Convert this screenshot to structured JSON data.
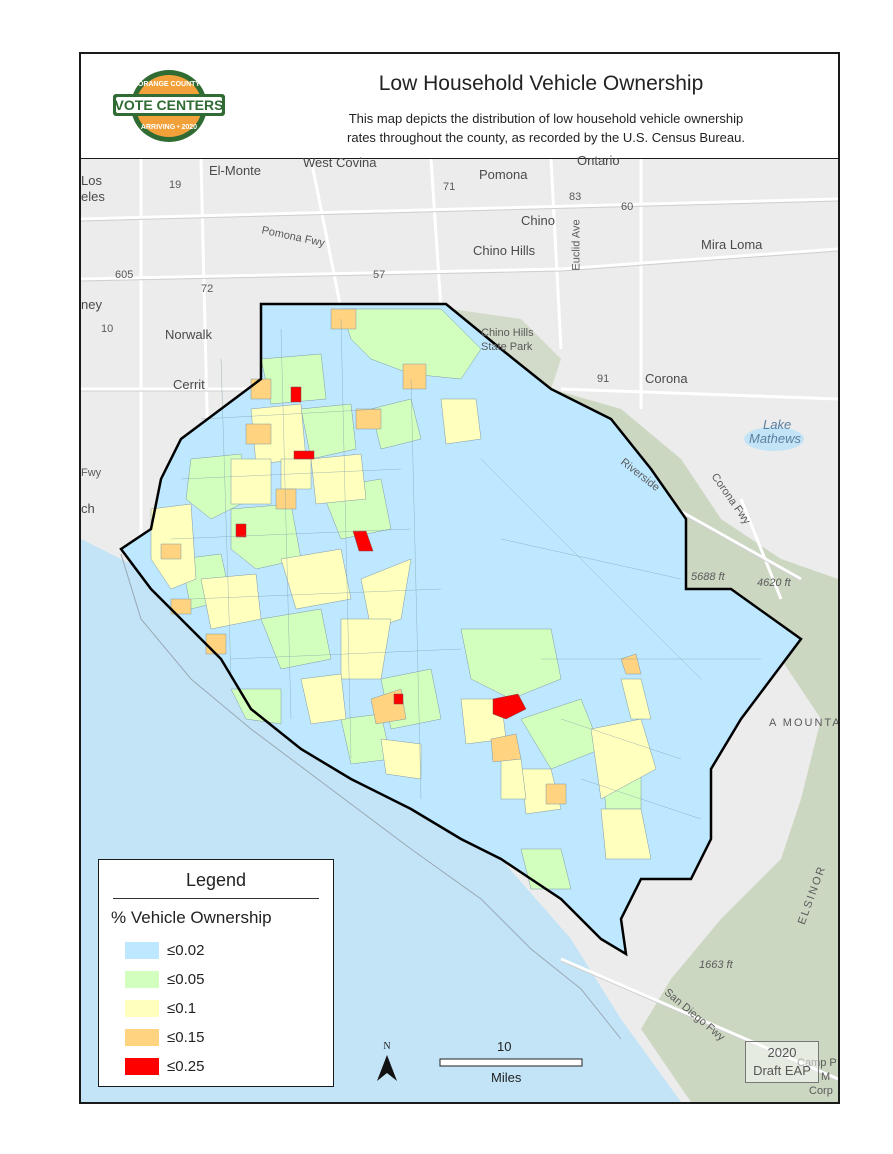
{
  "header": {
    "title": "Low Household Vehicle Ownership",
    "subtitle_line1": "This map depicts the distribution of low household vehicle ownership",
    "subtitle_line2": "rates throughout the county, as recorded by the U.S. Census Bureau.",
    "logo": {
      "top_text": "ORANGE COUNTY",
      "main_text": "VOTE CENTERS",
      "bottom_text": "ARRIVING • 2020"
    }
  },
  "map_labels": {
    "el_monte": "El-Monte",
    "west_covina": "West Covina",
    "ontario": "Ontario",
    "pomona": "Pomona",
    "los_angeles": "Los",
    "angeles": "eles",
    "chino": "Chino",
    "chino_hills": "Chino Hills",
    "mira_loma": "Mira Loma",
    "pomona_fwy": "Pomona Fwy",
    "euclid_ave": "Euclid Ave",
    "norwalk": "Norwalk",
    "cerritos": "Cerrit",
    "downey": "ney",
    "chino_hills_park_1": "Chino Hills",
    "chino_hills_park_2": "State Park",
    "corona": "Corona",
    "lake_mathews_1": "Lake",
    "lake_mathews_2": "Mathews",
    "riverside_fwy": "Riverside",
    "corona_fwy": "Corona Fwy",
    "peak_5688": "5688 ft",
    "peak_4620": "4620 ft",
    "peak_1663": "1663 ft",
    "san_diego_fwy": "San Diego Fwy",
    "camp_1": "Camp P",
    "camp_2": "M",
    "camp_3": "Corp",
    "mountains": "A MOUNTA",
    "elsinore": "ELSINOR",
    "fwy_left": "Fwy",
    "beach": "ch",
    "hwy_19": "19",
    "hwy_605": "605",
    "hwy_72": "72",
    "hwy_71": "71",
    "hwy_83": "83",
    "hwy_60": "60",
    "hwy_57": "57",
    "hwy_91": "91",
    "hwy_10": "10"
  },
  "legend": {
    "title": "Legend",
    "subtitle": "% Vehicle Ownership",
    "items": [
      {
        "label": "≤0.02",
        "color": "#bee8ff"
      },
      {
        "label": "≤0.05",
        "color": "#d3ffbe"
      },
      {
        "label": "≤0.1",
        "color": "#ffffbe"
      },
      {
        "label": "≤0.15",
        "color": "#ffd37f"
      },
      {
        "label": "≤0.25",
        "color": "#ff0000"
      }
    ]
  },
  "north_arrow": {
    "label": "N"
  },
  "scale_bar": {
    "value": "10",
    "unit": "Miles"
  },
  "draft": {
    "line1": "2020",
    "line2": "Draft EAP"
  },
  "colors": {
    "ocean": "#c2e4f6",
    "land": "#ececec",
    "hills": "#c7d4bb",
    "county_base": "#bee8ff",
    "boundary": "#000000"
  }
}
